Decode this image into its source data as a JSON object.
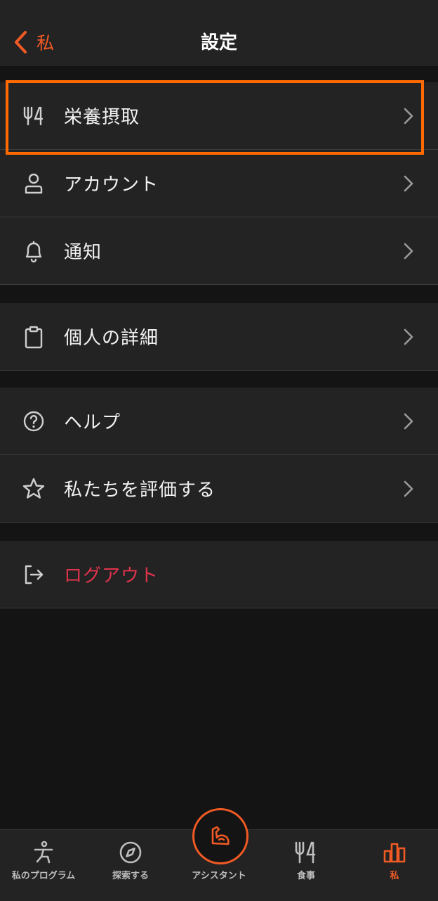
{
  "header": {
    "back_label": "私",
    "title": "設定"
  },
  "groups": [
    {
      "items": [
        {
          "label": "栄養摂取",
          "icon": "fork-knife-icon"
        },
        {
          "label": "アカウント",
          "icon": "person-icon"
        },
        {
          "label": "通知",
          "icon": "bell-icon"
        }
      ]
    },
    {
      "items": [
        {
          "label": "個人の詳細",
          "icon": "clipboard-icon"
        }
      ]
    },
    {
      "items": [
        {
          "label": "ヘルプ",
          "icon": "help-icon"
        },
        {
          "label": "私たちを評価する",
          "icon": "star-icon"
        }
      ]
    },
    {
      "items": [
        {
          "label": "ログアウト",
          "icon": "logout-icon"
        }
      ]
    }
  ],
  "tabbar": {
    "tabs": [
      {
        "label": "私のプログラム",
        "icon": "program-icon"
      },
      {
        "label": "探索する",
        "icon": "compass-icon"
      },
      {
        "label": "アシスタント",
        "icon": "muscle-icon"
      },
      {
        "label": "食事",
        "icon": "fork-knife-icon"
      },
      {
        "label": "私",
        "icon": "bar-chart-icon"
      }
    ]
  },
  "colors": {
    "accent": "#f15a24",
    "logout": "#e0344b",
    "highlight": "#ff6a00",
    "background": "#141414",
    "surface": "#232323"
  }
}
